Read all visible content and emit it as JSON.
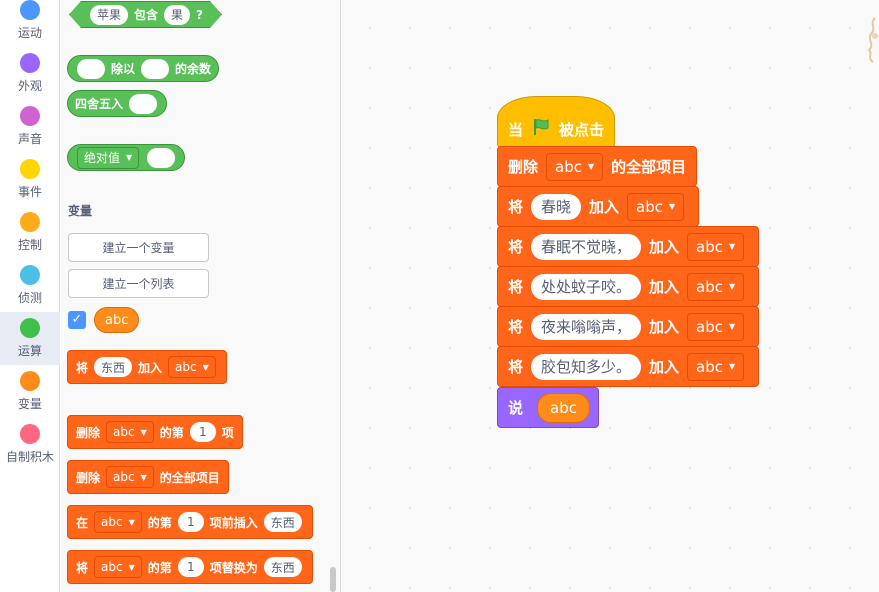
{
  "categories": [
    {
      "label": "运动",
      "color": "#4c97ff",
      "id": "motion"
    },
    {
      "label": "外观",
      "color": "#9966ff",
      "id": "looks"
    },
    {
      "label": "声音",
      "color": "#cf63cf",
      "id": "sound"
    },
    {
      "label": "事件",
      "color": "#ffd500",
      "id": "events"
    },
    {
      "label": "控制",
      "color": "#ffab19",
      "id": "control"
    },
    {
      "label": "侦测",
      "color": "#4cbfe6",
      "id": "sensing"
    },
    {
      "label": "运算",
      "color": "#40bf4a",
      "id": "operators",
      "selected": true
    },
    {
      "label": "变量",
      "color": "#ff8c1a",
      "id": "variables"
    },
    {
      "label": "自制积木",
      "color": "#ff6680",
      "id": "myblocks"
    }
  ],
  "palette": {
    "contains_block": {
      "text1": "苹果",
      "label": "包含",
      "text2": "果",
      "suffix": "?"
    },
    "mod_block": {
      "label1": "除以",
      "label2": "的余数"
    },
    "round_block": {
      "label": "四舍五入"
    },
    "abs_block": {
      "dropdown": "绝对值"
    },
    "variables_title": "变量",
    "make_variable_button": "建立一个变量",
    "make_list_button": "建立一个列表",
    "variable_reporter": "abc",
    "add_to_list": {
      "label1": "将",
      "item": "东西",
      "label2": "加入",
      "list": "abc"
    },
    "delete_item": {
      "label1": "删除",
      "list": "abc",
      "label2": "的第",
      "index": "1",
      "label3": "项"
    },
    "delete_all": {
      "label1": "删除",
      "list": "abc",
      "label2": "的全部项目"
    },
    "insert_at": {
      "label1": "在",
      "list": "abc",
      "label2": "的第",
      "index": "1",
      "label3": "项前插入",
      "item": "东西"
    },
    "replace_item": {
      "label1": "将",
      "list": "abc",
      "label2": "的第",
      "index": "1",
      "label3": "项替换为",
      "item": "东西"
    }
  },
  "script": {
    "hat": {
      "label1": "当",
      "icon": "green-flag-icon",
      "label2": "被点击"
    },
    "delete_all": {
      "label1": "删除",
      "list": "abc",
      "label2": "的全部项目"
    },
    "adds": [
      {
        "label1": "将",
        "item": "春晓",
        "label2": "加入",
        "list": "abc"
      },
      {
        "label1": "将",
        "item": "春眠不觉晓，",
        "label2": "加入",
        "list": "abc"
      },
      {
        "label1": "将",
        "item": "处处蚊子咬。",
        "label2": "加入",
        "list": "abc"
      },
      {
        "label1": "将",
        "item": "夜来嗡嗡声，",
        "label2": "加入",
        "list": "abc"
      },
      {
        "label1": "将",
        "item": "胶包知多少。",
        "label2": "加入",
        "list": "abc"
      }
    ],
    "say": {
      "label": "说",
      "reporter": "abc"
    }
  },
  "colors": {
    "operators": "#59c059",
    "list": "#ff661a",
    "variable": "#ff8c1a",
    "events": "#ffbf00",
    "looks": "#9966ff",
    "selected_category_bg": "#e6ebf4"
  }
}
